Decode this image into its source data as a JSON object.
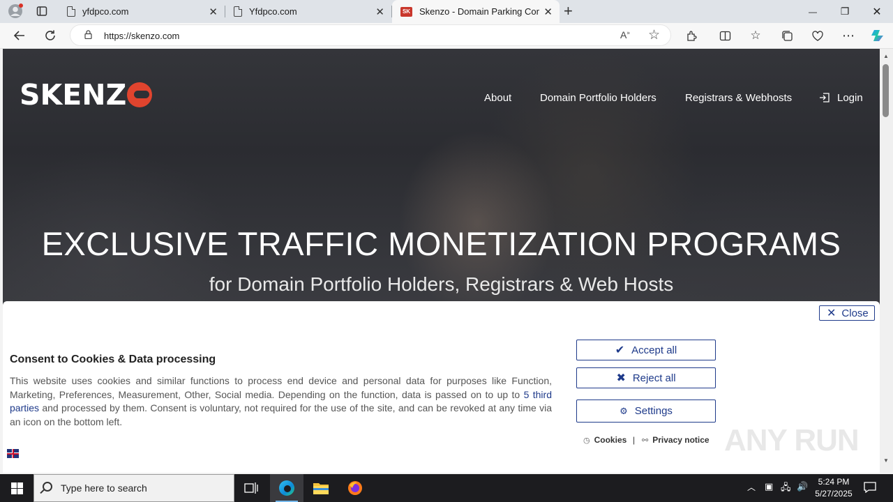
{
  "browser": {
    "tabs": [
      {
        "label": "yfdpco.com",
        "active": false
      },
      {
        "label": "Yfdpco.com",
        "active": false
      },
      {
        "label": "Skenzo - Domain Parking Compa",
        "active": true
      }
    ],
    "new_tab_glyph": "+",
    "window_controls": {
      "minimize": "—",
      "restore": "❐",
      "close": "✕"
    },
    "url": "https://skenzo.com"
  },
  "site": {
    "logo_text": "SKENZ",
    "nav": {
      "about": "About",
      "domain_portfolio_holders": "Domain Portfolio Holders",
      "registrars_webhosts": "Registrars & Webhosts",
      "login": "Login"
    },
    "hero": {
      "title": "EXCLUSIVE TRAFFIC MONETIZATION PROGRAMS",
      "subtitle": "for Domain Portfolio Holders, Registrars & Web Hosts"
    }
  },
  "consent": {
    "close_label": "Close",
    "title": "Consent to Cookies & Data processing",
    "text_before_link": "This website uses cookies and similar functions to process end device and personal data for purposes like Function, Marketing, Preferences, Measurement, Other, Social media. Depending on the function, data is passed on to up to ",
    "link_text": "5 third parties",
    "text_after_link": " and processed by them. Consent is voluntary, not required for the use of the site, and can be revoked at any time via an icon on the bottom left.",
    "accept_all": "Accept all",
    "reject_all": "Reject all",
    "settings": "Settings",
    "cookies_link": "Cookies",
    "separator": "|",
    "privacy_link": "Privacy notice",
    "accent_color": "#1e3a8a"
  },
  "watermark": "ANY RUN",
  "taskbar": {
    "search_placeholder": "Type here to search",
    "time": "5:24 PM",
    "date": "5/27/2025"
  }
}
